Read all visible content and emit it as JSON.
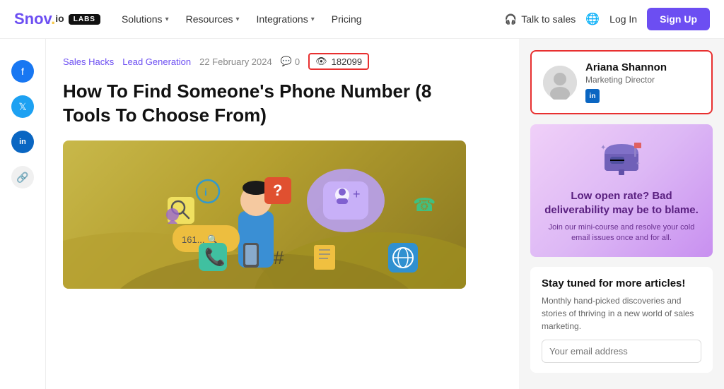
{
  "navbar": {
    "logo_main": "Snov",
    "logo_dot": ".",
    "logo_io": "io",
    "labs_label": "LABS",
    "nav_items": [
      {
        "label": "Solutions",
        "has_dropdown": true
      },
      {
        "label": "Resources",
        "has_dropdown": true
      },
      {
        "label": "Integrations",
        "has_dropdown": true
      },
      {
        "label": "Pricing",
        "has_dropdown": false
      }
    ],
    "talk_sales": "Talk to sales",
    "login_label": "Log In",
    "signup_label": "Sign Up"
  },
  "social_sidebar": {
    "items": [
      {
        "name": "facebook",
        "icon": "f"
      },
      {
        "name": "twitter",
        "icon": "𝕏"
      },
      {
        "name": "linkedin",
        "icon": "in"
      },
      {
        "name": "link",
        "icon": "🔗"
      }
    ]
  },
  "article": {
    "tag1": "Sales Hacks",
    "tag2": "Lead Generation",
    "date": "22 February 2024",
    "comments": "0",
    "views": "182099",
    "title": "How To Find Someone's Phone Number (8 Tools To Choose From)"
  },
  "author": {
    "name": "Ariana Shannon",
    "role": "Marketing Director",
    "avatar_icon": "👤"
  },
  "ad": {
    "icon": "📬",
    "title": "Low open rate? Bad deliverability may be to blame.",
    "description": "Join our mini-course and resolve your cold email issues once and for all."
  },
  "newsletter": {
    "title": "Stay tuned for more articles!",
    "description": "Monthly hand-picked discoveries and stories of thriving in a new world of sales marketing.",
    "email_placeholder": "Your email address"
  },
  "icons": {
    "headphone": "🎧",
    "globe": "🌐",
    "eye": "👁",
    "comment": "💬",
    "chevron": "▾"
  }
}
